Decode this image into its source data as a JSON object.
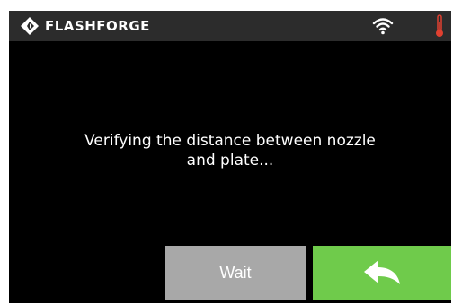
{
  "header": {
    "brand": "FLASHFORGE",
    "logo_icon": "flashforge-logo-icon",
    "wifi_icon": "wifi-icon",
    "temperature_icon": "thermometer-icon"
  },
  "main": {
    "message": "Verifying the distance between nozzle\nand plate..."
  },
  "footer": {
    "wait_label": "Wait",
    "back_icon": "back-arrow-icon"
  },
  "colors": {
    "background": "#000000",
    "header_bg": "#2c2c2c",
    "wait_button": "#a8a8a8",
    "back_button": "#6fcb4b",
    "thermometer": "#e04030"
  }
}
